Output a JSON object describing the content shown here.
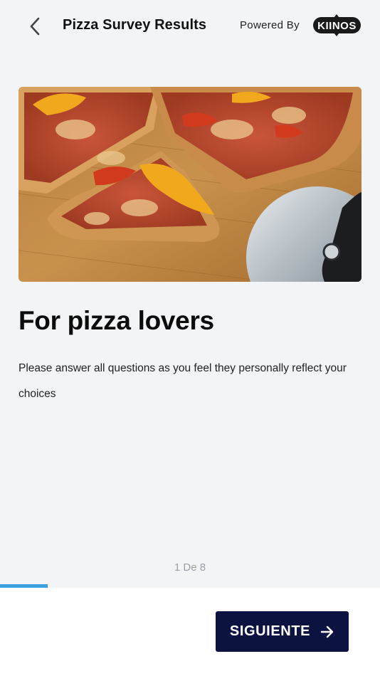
{
  "header": {
    "title": "Pizza Survey Results",
    "powered_by": "Powered By",
    "logo_text": "KIINOS"
  },
  "hero": {
    "alt": "Pizza slices with peppers on a wooden board next to a pizza cutter"
  },
  "content": {
    "headline": "For pizza lovers",
    "description": "Please answer all questions as you feel they personally reflect your choices"
  },
  "pager": {
    "indicator": "1 De 8",
    "current": 1,
    "total": 8,
    "progress_fraction": 0.125
  },
  "footer": {
    "next_label": "SIGUIENTE"
  },
  "colors": {
    "background": "#f3f4f6",
    "primary_button": "#0d1340",
    "progress": "#3aa0e0"
  }
}
